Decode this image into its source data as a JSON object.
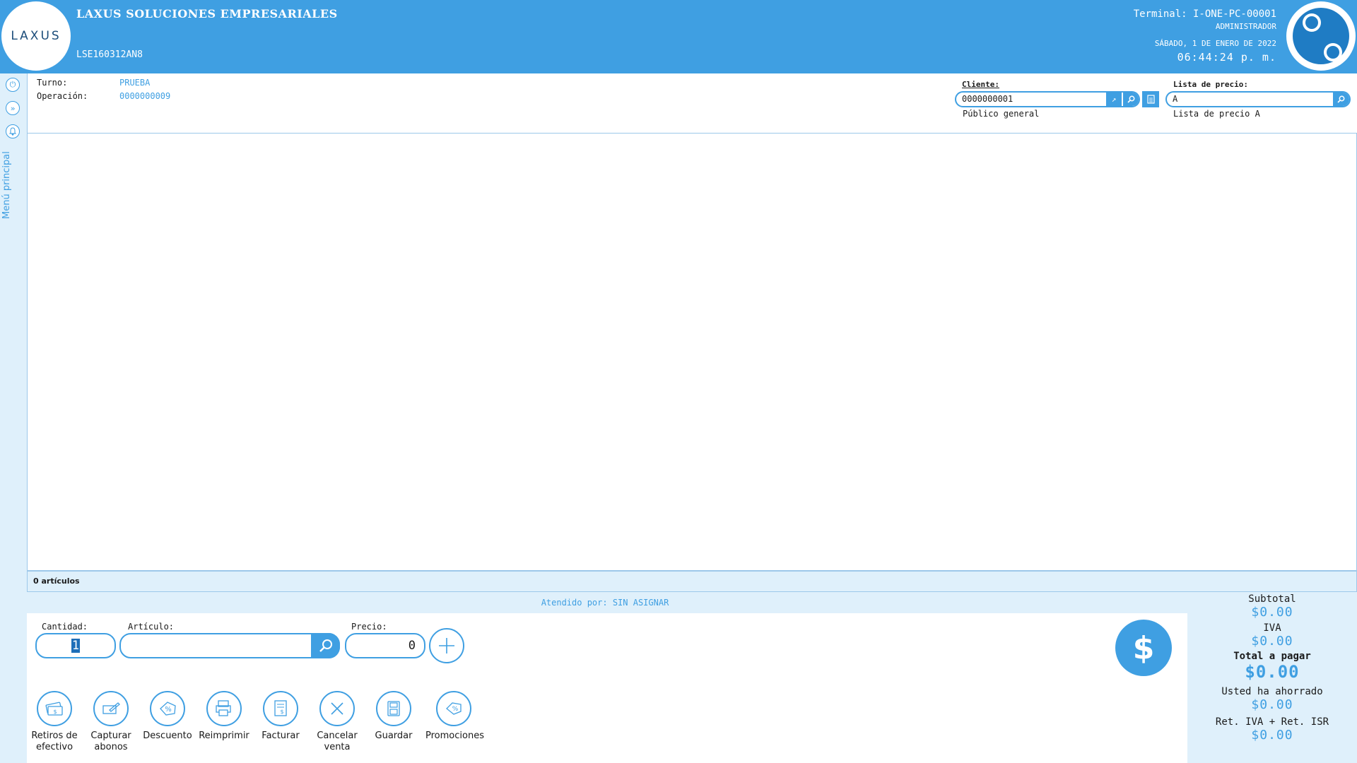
{
  "header": {
    "logo_text": "LAXUS",
    "company_name": "LAXUS SOLUCIONES EMPRESARIALES",
    "rfc": "LSE160312AN8",
    "terminal": "Terminal: I-ONE-PC-00001",
    "role": "ADMINISTRADOR",
    "date": "SÁBADO, 1 DE ENERO DE 2022",
    "time": "06:44:24 p. m."
  },
  "sidebar": {
    "menu_label": "Menú principal",
    "icons": [
      "power-icon",
      "chevrons-right-icon",
      "bell-icon"
    ]
  },
  "info": {
    "turno_label": "Turno:",
    "turno_value": "PRUEBA",
    "operacion_label": "Operación:",
    "operacion_value": "0000000009",
    "cliente_label": "Cliente:",
    "cliente_value": "0000000001",
    "cliente_name": "Público general",
    "lista_label": "Lista de precio:",
    "lista_value": "A",
    "lista_name": "Lista de precio A"
  },
  "table": {
    "items_count": "0 artículos"
  },
  "entry": {
    "attended_by": "Atendido por: SIN ASIGNAR",
    "cantidad_label": "Cantidad:",
    "cantidad_value": "1",
    "articulo_label": "Artículo:",
    "articulo_value": "",
    "precio_label": "Precio:",
    "precio_value": "0"
  },
  "actions": [
    {
      "label1": "Retiros de",
      "label2": "efectivo",
      "icon": "cash-withdrawal-icon"
    },
    {
      "label1": "Capturar",
      "label2": "abonos",
      "icon": "payment-capture-icon"
    },
    {
      "label1": "Descuento",
      "label2": "",
      "icon": "discount-icon"
    },
    {
      "label1": "Reimprimir",
      "label2": "",
      "icon": "reprint-icon"
    },
    {
      "label1": "Facturar",
      "label2": "",
      "icon": "invoice-icon"
    },
    {
      "label1": "Cancelar",
      "label2": "venta",
      "icon": "cancel-icon"
    },
    {
      "label1": "Guardar",
      "label2": "",
      "icon": "save-icon"
    },
    {
      "label1": "Promociones",
      "label2": "",
      "icon": "promotions-icon"
    }
  ],
  "pay_symbol": "$",
  "totals": {
    "subtotal_label": "Subtotal",
    "subtotal_value": "$0.00",
    "iva_label": "IVA",
    "iva_value": "$0.00",
    "total_label": "Total a pagar",
    "total_value": "$0.00",
    "saved_label": "Usted ha ahorrado",
    "saved_value": "$0.00",
    "ret_label": "Ret. IVA + Ret. ISR",
    "ret_value": "$0.00"
  },
  "colors": {
    "accent": "#3f9fe2",
    "panel": "#dff0fb"
  }
}
